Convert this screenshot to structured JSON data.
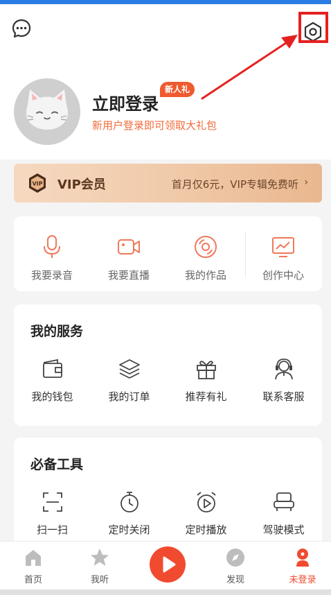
{
  "header": {
    "login_title": "立即登录",
    "login_subtitle": "新用户登录即可领取大礼包",
    "new_badge": "新人礼"
  },
  "vip": {
    "title": "VIP会员",
    "description": "首月仅6元，VIP专辑免费听",
    "chevron": "›",
    "icon_text": "VIP"
  },
  "quick_actions": [
    {
      "label": "我要录音",
      "icon": "microphone-icon"
    },
    {
      "label": "我要直播",
      "icon": "video-camera-icon"
    },
    {
      "label": "我的作品",
      "icon": "disc-icon"
    },
    {
      "label": "创作中心",
      "icon": "chart-monitor-icon"
    }
  ],
  "services": {
    "title": "我的服务",
    "items": [
      {
        "label": "我的钱包",
        "icon": "wallet-icon"
      },
      {
        "label": "我的订单",
        "icon": "layers-icon"
      },
      {
        "label": "推荐有礼",
        "icon": "gift-icon"
      },
      {
        "label": "联系客服",
        "icon": "headset-icon"
      }
    ]
  },
  "tools": {
    "title": "必备工具",
    "items": [
      {
        "label": "扫一扫",
        "icon": "scan-icon"
      },
      {
        "label": "定时关闭",
        "icon": "timer-icon"
      },
      {
        "label": "定时播放",
        "icon": "alarm-play-icon"
      },
      {
        "label": "驾驶模式",
        "icon": "car-seat-icon"
      }
    ]
  },
  "bottom_nav": {
    "items": [
      {
        "label": "首页",
        "icon": "home-icon"
      },
      {
        "label": "我听",
        "icon": "star-icon"
      },
      {
        "label": "发现",
        "icon": "compass-icon"
      },
      {
        "label": "未登录",
        "icon": "user-icon"
      }
    ]
  },
  "colors": {
    "accent": "#f26b3a",
    "badge": "#ef5a2e",
    "play_button": "#f04b30",
    "annotation": "#e62020"
  }
}
